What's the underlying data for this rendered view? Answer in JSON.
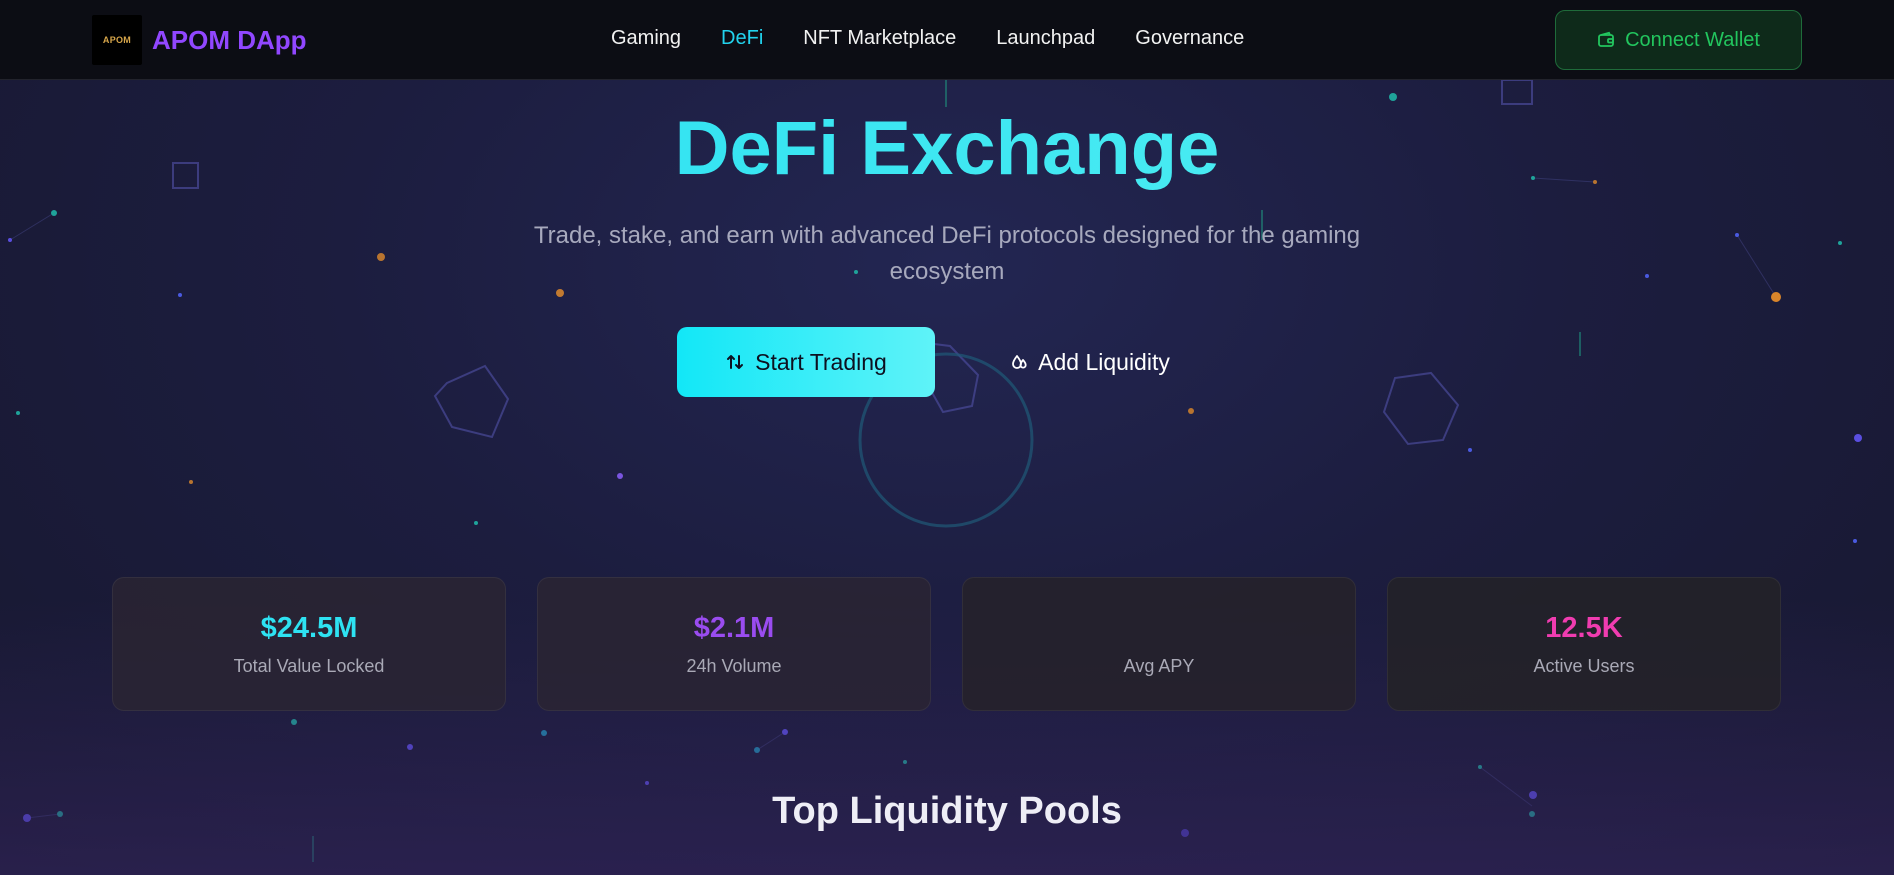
{
  "app": {
    "logo_text": "APOM",
    "name": "APOM DApp"
  },
  "nav": {
    "items": [
      {
        "label": "Gaming",
        "active": false
      },
      {
        "label": "DeFi",
        "active": true
      },
      {
        "label": "NFT Marketplace",
        "active": false
      },
      {
        "label": "Launchpad",
        "active": false
      },
      {
        "label": "Governance",
        "active": false
      }
    ],
    "connect_label": "Connect Wallet"
  },
  "hero": {
    "title": "DeFi Exchange",
    "subtitle": "Trade, stake, and earn with advanced DeFi protocols designed for the gaming ecosystem",
    "primary_label": "Start Trading",
    "secondary_label": "Add Liquidity"
  },
  "stats": [
    {
      "value": "$24.5M",
      "label": "Total Value Locked",
      "color": "#2ee2f2"
    },
    {
      "value": "$2.1M",
      "label": "24h Volume",
      "color": "#9a4cf0"
    },
    {
      "value": "",
      "label": "Avg APY",
      "color": "#22c55e"
    },
    {
      "value": "12.5K",
      "label": "Active Users",
      "color": "#f03cb0"
    }
  ],
  "sections": {
    "pools_title": "Top Liquidity Pools"
  },
  "colors": {
    "accent": "#22d3ee",
    "brand": "#9147ff",
    "wallet": "#22c55e"
  }
}
